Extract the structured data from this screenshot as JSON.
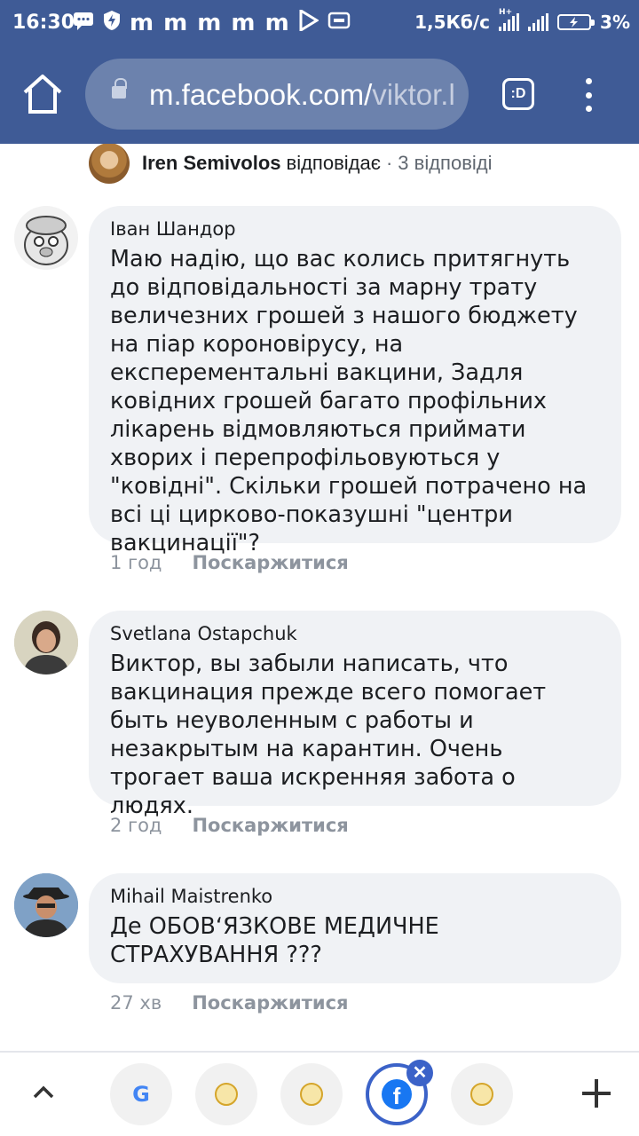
{
  "status_bar": {
    "time": "16:30",
    "notification_letters": "m m m m m",
    "net_speed": "1,5Кб/с",
    "network_type": "H+",
    "battery": "3%"
  },
  "browser": {
    "url_host": "m.facebook.com/",
    "url_path": "viktor.l",
    "tabs_label": ":D"
  },
  "thread_header": {
    "name": "Iren Semivolos",
    "action": "відповідає",
    "separator": "·",
    "replies": "3 відповіді"
  },
  "comments": [
    {
      "author": "Іван Шандор",
      "text": "Маю надію, що вас колись притягнуть до відповідальності за марну трату величезних грошей з нашого бюджету на піар короновірусу, на експерементальні вакцини, Задля ковідних грошей багато профільних лікарень відмовляються приймати хворих і перепрофільовуються у \"ковідні\". Скільки грошей потрачено на всі ці цирково-показушні \"центри вакцинації\"?",
      "time": "1 год",
      "report": "Поскаржитися"
    },
    {
      "author": "Svetlana Ostapchuk",
      "text": "Виктор, вы забыли написать, что вакцинация прежде всего помогает быть неуволенным с работы и незакрытым на карантин. Очень трогает ваша искренняя забота о людях.",
      "time": "2 год",
      "report": "Поскаржитися"
    },
    {
      "author": "Mihail Maistrenko",
      "text": "Де ОБОВʻЯЗКОВЕ МЕДИЧНЕ СТРАХУВАННЯ ???",
      "time": "27 хв",
      "report": "Поскаржитися"
    }
  ],
  "bottom_bar": {
    "google_label": "G",
    "facebook_label": "f",
    "close_label": "✕"
  },
  "colors": {
    "header": "#3f5b96",
    "bubble": "#f0f2f5",
    "active_tab": "#3b62c8"
  }
}
